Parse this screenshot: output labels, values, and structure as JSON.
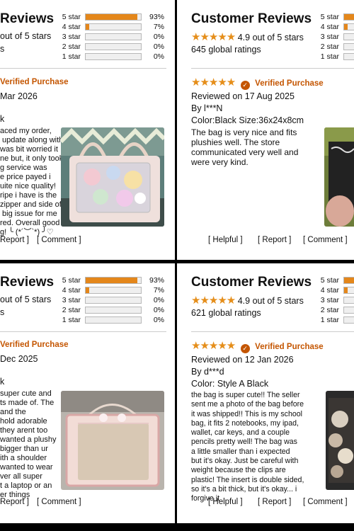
{
  "labels": {
    "title": "Customer Reviews",
    "out_of": "4.9 out of 5 stars",
    "out_of_cropped": "out of 5 stars",
    "verified": "Verified Purchase",
    "helpful": "[ Helpful ]",
    "report": "[ Report ]",
    "report_cropped": "Report ]",
    "comment": "[ Comment ]",
    "rating_stars": "★★★★★"
  },
  "histogram_labels": [
    "5 star",
    "4 star",
    "3 star",
    "2 star",
    "1 star"
  ],
  "colors": {
    "star_gold": "#e58e1a",
    "bar_fill": "#e4871b",
    "verified_orange": "#c45500"
  },
  "panels": [
    {
      "title_cropped": "Reviews",
      "histogram": [
        93,
        7,
        0,
        0,
        0
      ],
      "histogram_pct": [
        "93%",
        "7%",
        "0%",
        "0%",
        "0%"
      ],
      "date": "Mar 2026",
      "author": "k",
      "body": "aced my order,\n update along with\nwas bit worried it\nne but, it only took\ng service was\ne price payed i\nuite nice quality!\nripe i have is the\nzipper and side of\n big issue for me\nred. Overall good\ng! ╰ (*´︶`*) ╯♡",
      "photo_icon": "bag-photo-icon"
    },
    {
      "ratings": "645 global ratings",
      "histogram": [
        93,
        7,
        0,
        0,
        0
      ],
      "date": "Reviewed on 17 Aug 2025",
      "author": "By l***N",
      "variant": "Color:Black  Size:36x24x8cm",
      "body": "The bag is very nice and fits\nplushies well. The store\ncommunicated very well and\nwere very kind.",
      "photo_icon": "bag-photo-icon"
    },
    {
      "title_cropped": "Reviews",
      "histogram": [
        93,
        7,
        0,
        0,
        0
      ],
      "histogram_pct": [
        "93%",
        "7%",
        "0%",
        "0%",
        "0%"
      ],
      "date": "Dec 2025",
      "author": "k",
      "body": "super cute and\nts made of. The\nand the\nhold adorable\nthey arent too\nwanted a plushy\nbigger than ur\nith a shoulder\nwanted to wear\nver all super\nt a laptop or an\ner things",
      "photo_icon": "bag-photo-icon"
    },
    {
      "ratings": "621 global ratings",
      "histogram": [
        93,
        7,
        0,
        0,
        0
      ],
      "date": "Reviewed on 12 Jan 2026",
      "author": "By d***d",
      "variant": "Color: Style A Black",
      "body": "the bag is super cute!! The seller\nsent me a photo of the bag before\nit was shipped!! This is my school\nbag, it fits 2 notebooks, my ipad,\nwallet, car keys, and a couple\npencils pretty well! The bag was\na little smaller than i expected\nbut it's okay. Just be careful with\nweight because the clips are\nplastic! The insert is double sided,\nso it's a bit thick, but it's okay... i\nforgive it",
      "photo_icon": "bag-photo-icon"
    }
  ]
}
